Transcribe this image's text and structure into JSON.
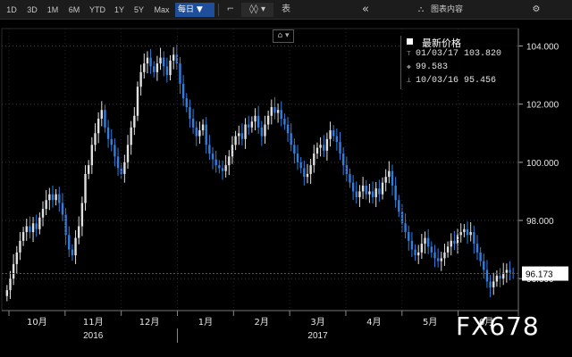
{
  "toolbar": {
    "ranges": [
      "1D",
      "3D",
      "1M",
      "6M",
      "YTD",
      "1Y",
      "5Y",
      "Max"
    ],
    "interval": "每日 ▼",
    "line_icon": "⌐",
    "candle_icon": "◊◊ ▾",
    "table_label": "表",
    "collapse_icon": "«",
    "chart_content_label": "图表内容",
    "settings_icon": "⚙"
  },
  "chart_type_button": "⌂ ▾",
  "legend": {
    "title": "最新价格",
    "high_label": "01/03/17 103.820",
    "last_label": "99.583",
    "low_label": "10/03/16 95.456",
    "swatch_color": "#ffffff"
  },
  "watermark": "FX678",
  "chart_data": {
    "type": "candlestick",
    "title": "",
    "y_ticks": [
      "104.000",
      "102.000",
      "100.000",
      "98.000",
      "96.000"
    ],
    "y_tick_values": [
      104,
      102,
      100,
      98,
      96
    ],
    "ylim": [
      94.9,
      104.6
    ],
    "x_month_labels": [
      "10月",
      "11月",
      "12月",
      "1月",
      "2月",
      "3月",
      "4月",
      "5月",
      "6月"
    ],
    "x_year_labels": [
      {
        "label": "2016",
        "month_index": 1.5
      },
      {
        "label": "2017",
        "month_index": 5.5
      }
    ],
    "last_price": "96.173",
    "last_price_value": 96.173,
    "up_color": "#e0e0e0",
    "down_color": "#2f7ee0",
    "closes": [
      95.6,
      96.0,
      96.5,
      96.9,
      97.3,
      97.6,
      97.8,
      97.6,
      97.9,
      97.7,
      98.1,
      98.4,
      98.7,
      98.9,
      98.7,
      98.9,
      98.6,
      98.2,
      97.5,
      97.0,
      96.8,
      97.4,
      97.8,
      98.6,
      99.6,
      99.9,
      100.6,
      101.0,
      101.5,
      101.8,
      101.2,
      100.8,
      100.6,
      100.2,
      99.8,
      99.6,
      100.0,
      100.6,
      101.2,
      101.6,
      102.6,
      103.1,
      103.4,
      103.6,
      103.3,
      103.1,
      103.4,
      103.6,
      103.3,
      103.0,
      103.5,
      103.7,
      103.4,
      102.7,
      102.2,
      101.9,
      101.5,
      101.2,
      100.9,
      101.1,
      101.3,
      100.6,
      100.3,
      100.1,
      99.9,
      99.8,
      99.7,
      99.9,
      100.2,
      100.6,
      100.9,
      101.0,
      100.8,
      101.3,
      101.2,
      101.4,
      101.6,
      101.2,
      100.9,
      101.3,
      101.6,
      101.9,
      101.7,
      101.8,
      101.5,
      101.3,
      101.0,
      100.6,
      100.3,
      100.0,
      99.8,
      99.5,
      99.6,
      99.9,
      100.3,
      100.5,
      100.6,
      100.4,
      100.8,
      101.1,
      100.9,
      100.7,
      100.3,
      99.9,
      99.6,
      99.3,
      99.0,
      98.8,
      99.0,
      99.2,
      98.9,
      99.0,
      98.8,
      99.1,
      98.9,
      99.3,
      99.5,
      99.7,
      99.2,
      98.7,
      98.3,
      97.9,
      97.6,
      97.3,
      97.0,
      96.8,
      96.9,
      97.2,
      97.4,
      97.1,
      96.9,
      96.7,
      96.6,
      96.7,
      96.9,
      97.1,
      97.3,
      97.2,
      97.5,
      97.6,
      97.7,
      97.5,
      97.6,
      97.2,
      96.9,
      96.6,
      96.3,
      95.9,
      95.7,
      95.9,
      96.1,
      96.0,
      96.2,
      96.3,
      96.2,
      96.173
    ]
  }
}
